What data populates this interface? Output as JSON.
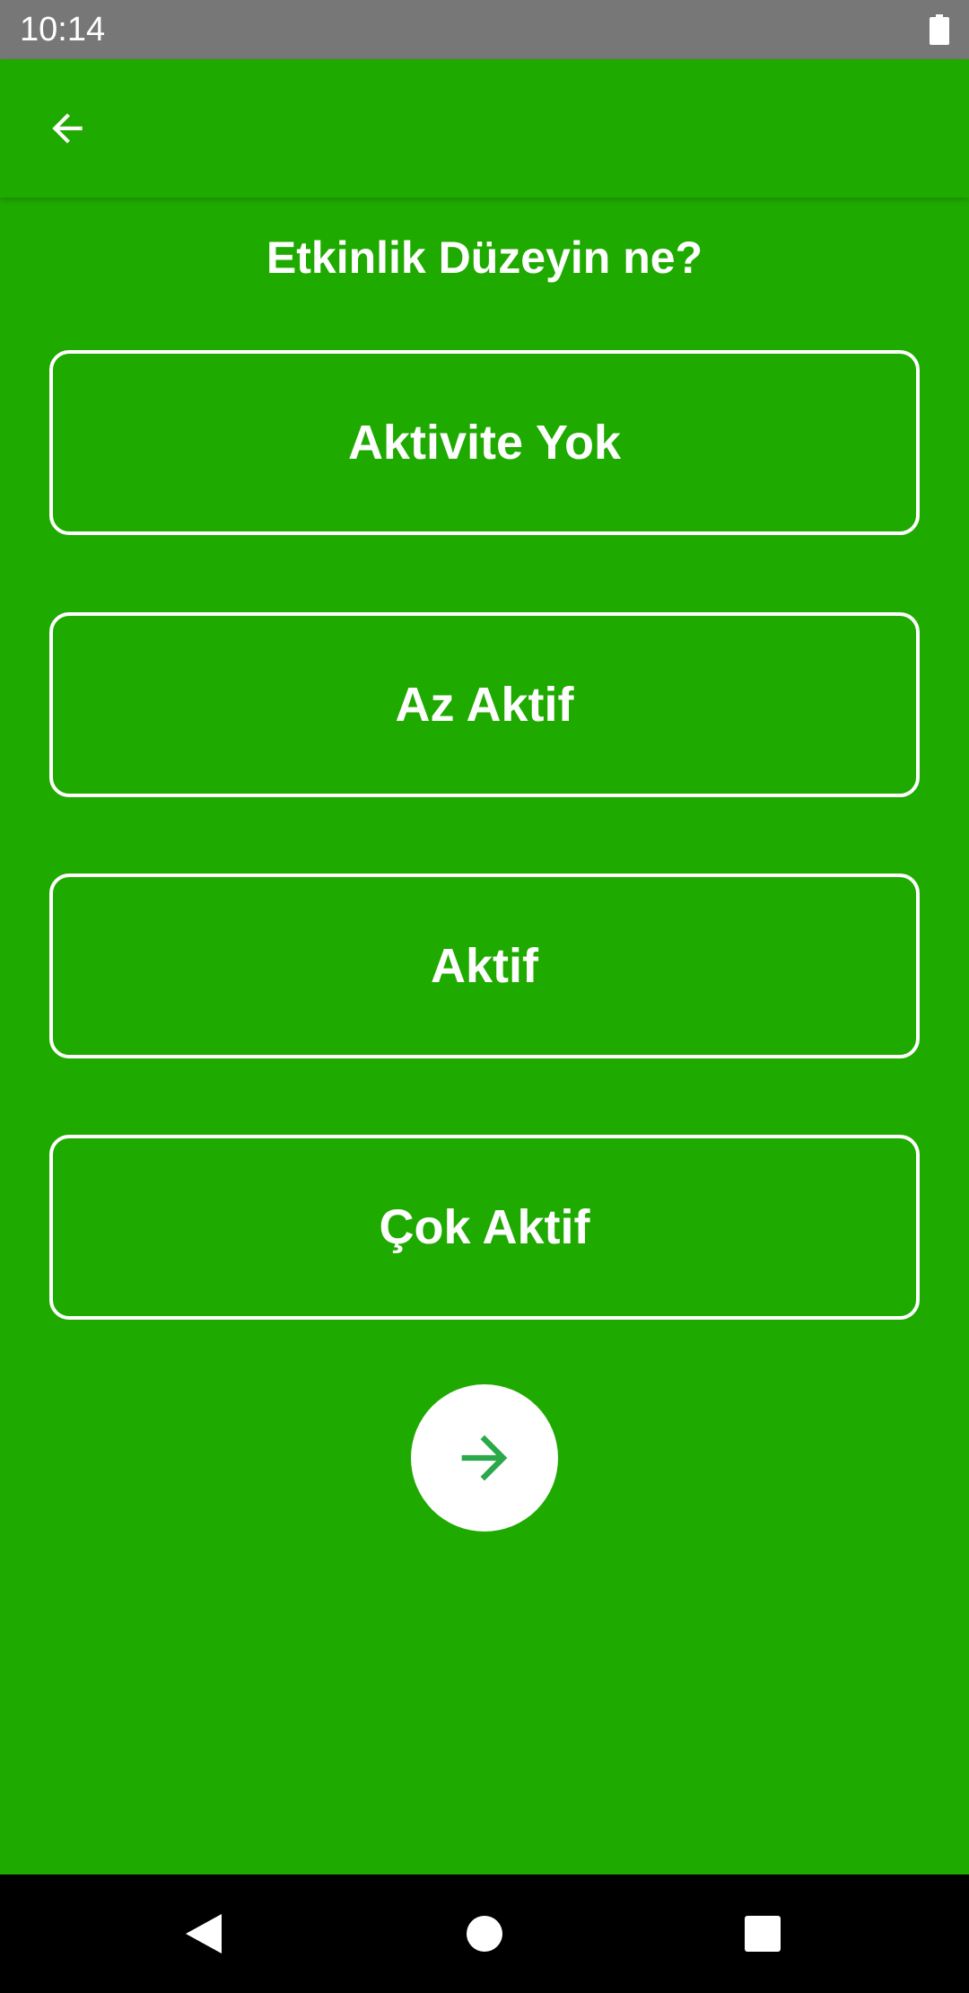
{
  "status_bar": {
    "time": "10:14",
    "battery_icon": "battery-full-icon"
  },
  "app_bar": {
    "back_icon": "arrow-left-icon"
  },
  "question": {
    "title": "Etkinlik Düzeyin ne?"
  },
  "options": [
    {
      "label": "Aktivite Yok"
    },
    {
      "label": "Az Aktif"
    },
    {
      "label": "Aktif"
    },
    {
      "label": "Çok Aktif"
    }
  ],
  "next_button": {
    "icon": "arrow-right-icon",
    "icon_color": "#2aa84a"
  },
  "nav_bar": {
    "back_icon": "triangle-back-icon",
    "home_icon": "circle-home-icon",
    "recents_icon": "square-recents-icon"
  },
  "colors": {
    "background": "#1faa00",
    "status_bar": "#777777",
    "nav_bar": "#000000",
    "text": "#ffffff"
  }
}
